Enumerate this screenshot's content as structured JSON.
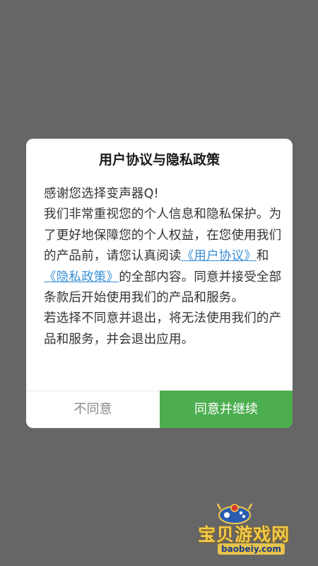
{
  "dialog": {
    "title": "用户协议与隐私政策",
    "paragraph1": {
      "line1": "感谢您选择变声器Q!",
      "part1": "我们非常重视您的个人信息和隐私保护。为了更好地保障您的个人权益，在您使用我们的产品前，请您认真阅读",
      "link1": "《用户协议》",
      "and": "和",
      "link2": "《隐私政策》",
      "part2": "的全部内容。同意并接受全部条款后开始使用我们的产品和服务。"
    },
    "paragraph2": "若选择不同意并退出，将无法使用我们的产品和服务，并会退出应用。",
    "disagree_label": "不同意",
    "agree_label": "同意并继续"
  },
  "watermark": {
    "name": "宝贝游戏网",
    "url": "baobeiy.com"
  },
  "colors": {
    "overlay": "#666666",
    "agree_button": "#4cae4f",
    "link": "#3a8fd6"
  }
}
